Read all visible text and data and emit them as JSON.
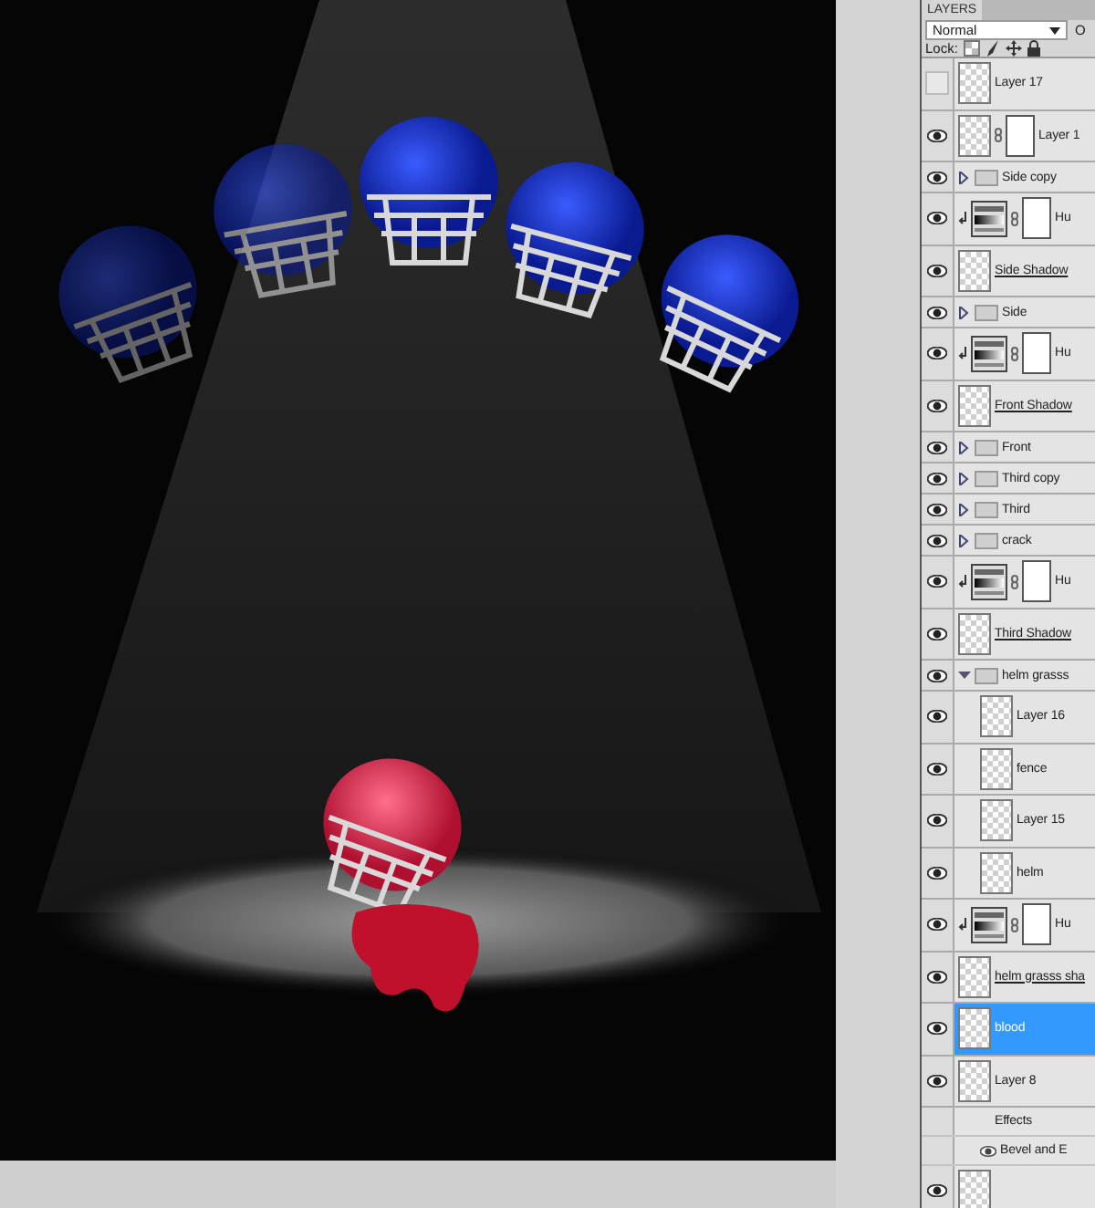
{
  "panel": {
    "tab": "LAYERS",
    "blend_mode": "Normal",
    "opacity_label": "O",
    "lock_label": "Lock:"
  },
  "layers": [
    {
      "kind": "layer",
      "name": "Layer 17",
      "visible": false,
      "selected": false,
      "clip_base": false
    },
    {
      "kind": "masked",
      "name": "Layer 1",
      "visible": true,
      "selected": false,
      "clip_base": false
    },
    {
      "kind": "group",
      "name": "Side copy",
      "visible": true,
      "selected": false,
      "expanded": false
    },
    {
      "kind": "adjustment",
      "name": "Hu",
      "visible": true,
      "selected": false
    },
    {
      "kind": "layer",
      "name": "Side Shadow",
      "visible": true,
      "selected": false,
      "clip_base": true
    },
    {
      "kind": "group",
      "name": "Side",
      "visible": true,
      "selected": false,
      "expanded": false
    },
    {
      "kind": "adjustment",
      "name": "Hu",
      "visible": true,
      "selected": false
    },
    {
      "kind": "layer",
      "name": "Front Shadow",
      "visible": true,
      "selected": false,
      "clip_base": true
    },
    {
      "kind": "group",
      "name": "Front",
      "visible": true,
      "selected": false,
      "expanded": false
    },
    {
      "kind": "group",
      "name": "Third copy",
      "visible": true,
      "selected": false,
      "expanded": false
    },
    {
      "kind": "group",
      "name": "Third",
      "visible": true,
      "selected": false,
      "expanded": false
    },
    {
      "kind": "group",
      "name": "crack",
      "visible": true,
      "selected": false,
      "expanded": false
    },
    {
      "kind": "adjustment",
      "name": "Hu",
      "visible": true,
      "selected": false
    },
    {
      "kind": "layer",
      "name": "Third Shadow",
      "visible": true,
      "selected": false,
      "clip_base": true
    },
    {
      "kind": "group",
      "name": "helm grasss",
      "visible": true,
      "selected": false,
      "expanded": true,
      "children": [
        {
          "kind": "layer",
          "name": "Layer 16",
          "visible": true,
          "selected": false,
          "clip_base": false
        },
        {
          "kind": "layer",
          "name": "fence",
          "visible": true,
          "selected": false,
          "clip_base": false
        },
        {
          "kind": "layer",
          "name": "Layer 15",
          "visible": true,
          "selected": false,
          "clip_base": false
        },
        {
          "kind": "layer",
          "name": "helm",
          "visible": true,
          "selected": false,
          "clip_base": false
        }
      ]
    },
    {
      "kind": "adjustment",
      "name": "Hu",
      "visible": true,
      "selected": false
    },
    {
      "kind": "layer",
      "name": "helm grasss sha",
      "visible": true,
      "selected": false,
      "clip_base": true
    },
    {
      "kind": "layer",
      "name": "blood",
      "visible": true,
      "selected": true,
      "clip_base": false
    },
    {
      "kind": "layer",
      "name": "Layer 8",
      "visible": true,
      "selected": false,
      "clip_base": false,
      "effects": {
        "label": "Effects",
        "items": [
          {
            "name": "Bevel and E",
            "visible": true
          }
        ]
      }
    },
    {
      "kind": "layer",
      "visible": true,
      "selected": false
    }
  ]
}
